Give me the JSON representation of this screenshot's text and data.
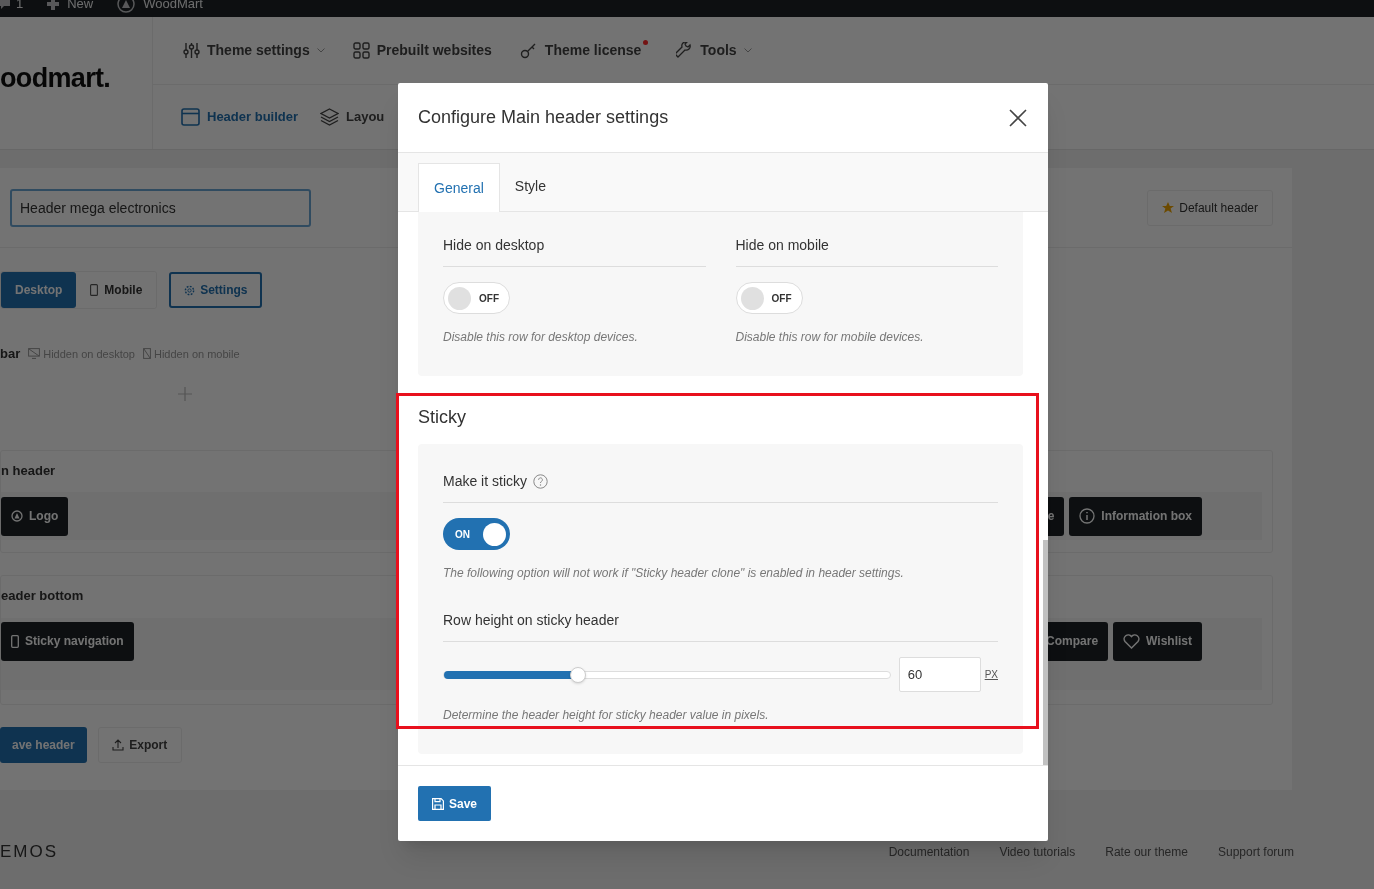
{
  "admin_bar": {
    "comments": "1",
    "new": "New",
    "site": "WoodMart"
  },
  "logo": "oodmart.",
  "nav_top": [
    {
      "label": "Theme settings",
      "dropdown": true,
      "notice": false
    },
    {
      "label": "Prebuilt websites",
      "dropdown": false,
      "notice": false
    },
    {
      "label": "Theme license",
      "dropdown": false,
      "notice": true
    },
    {
      "label": "Tools",
      "dropdown": true,
      "notice": false
    }
  ],
  "nav_bottom": [
    {
      "label": "Header builder",
      "selected": true
    },
    {
      "label": "Layou",
      "selected": false
    }
  ],
  "builder": {
    "header_name": "Header mega electronics",
    "default_button": "Default header",
    "devices": [
      {
        "label": "Desktop",
        "selected": true
      },
      {
        "label": "Mobile",
        "selected": false
      }
    ],
    "settings_button": "Settings",
    "top_bar": {
      "title": "bar",
      "flags": [
        "Hidden on desktop",
        "Hidden on mobile"
      ]
    },
    "main_header": {
      "title": "n header",
      "left": [
        "Logo"
      ],
      "right": [
        "e",
        "Information box"
      ]
    },
    "header_bottom": {
      "title": "eader bottom",
      "left": [
        "Sticky navigation"
      ],
      "right": [
        "Compare",
        "Wishlist"
      ]
    },
    "actions": [
      "ave header",
      "Export"
    ]
  },
  "footer": {
    "brand": "EMOS",
    "links": [
      "Documentation",
      "Video tutorials",
      "Rate our theme",
      "Support forum"
    ]
  },
  "modal": {
    "title": "Configure Main header settings",
    "tabs": [
      {
        "label": "General",
        "selected": true
      },
      {
        "label": "Style",
        "selected": false
      }
    ],
    "visibility": [
      {
        "label": "Hide on desktop",
        "on": false,
        "toggle_text": "OFF",
        "description": "Disable this row for desktop devices."
      },
      {
        "label": "Hide on mobile",
        "on": false,
        "toggle_text": "OFF",
        "description": "Disable this row for mobile devices."
      }
    ],
    "sticky": {
      "heading": "Sticky",
      "make_sticky": {
        "label": "Make it sticky",
        "on": true,
        "toggle_text": "ON"
      },
      "note": "The following option will not work if \"Sticky header clone\" is enabled in header settings.",
      "row_height": {
        "label": "Row height on sticky header",
        "level": 0.3,
        "value": "60",
        "unit": "PX",
        "description": "Determine the header height for sticky header value in pixels."
      }
    },
    "save_button": "Save"
  }
}
